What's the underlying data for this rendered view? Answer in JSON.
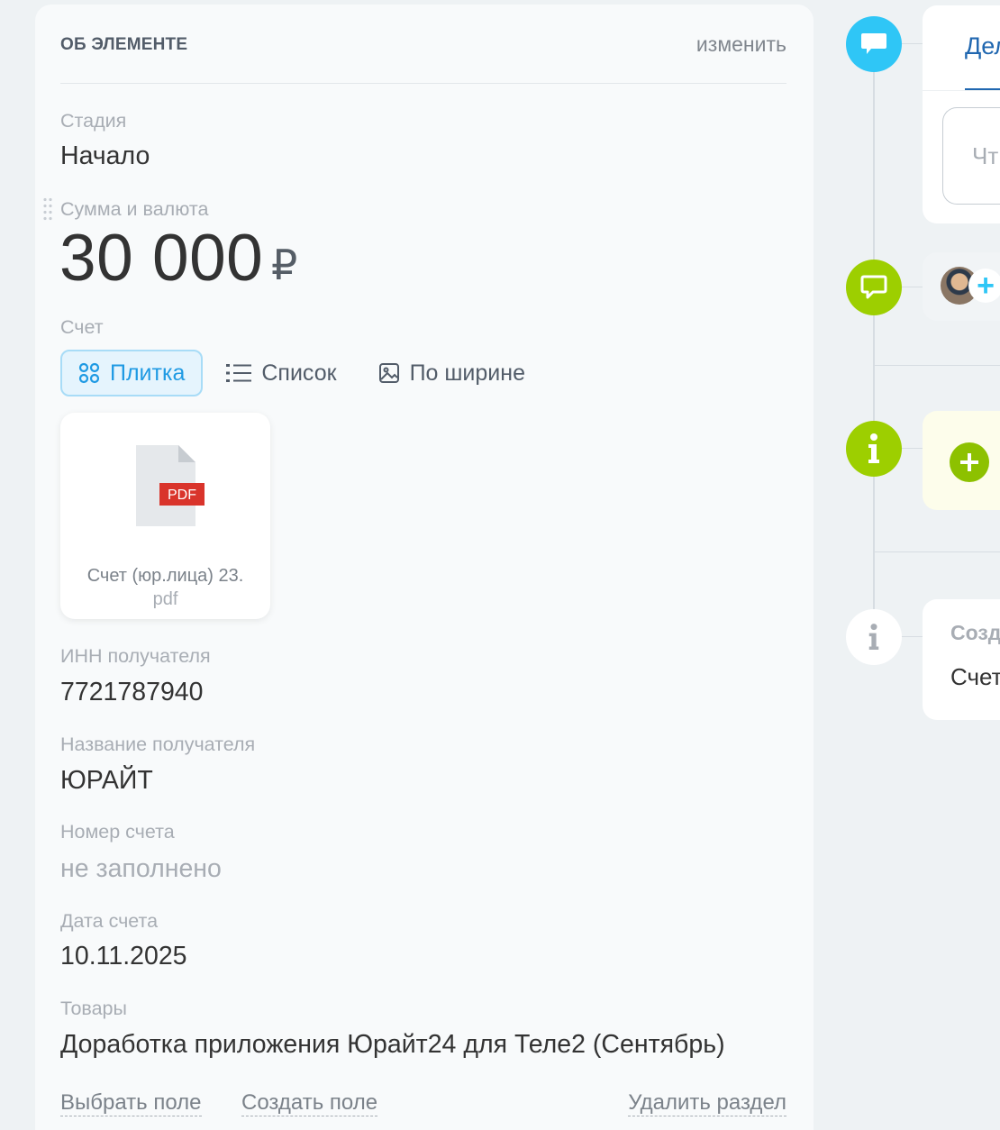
{
  "section": {
    "title": "ОБ ЭЛЕМЕНТЕ",
    "edit_label": "изменить"
  },
  "fields": {
    "stage": {
      "label": "Стадия",
      "value": "Начало"
    },
    "amount": {
      "label": "Сумма и валюта",
      "value": "30 000",
      "currency": "₽"
    },
    "invoice": {
      "label": "Счет"
    },
    "inn": {
      "label": "ИНН получателя",
      "value": "7721787940"
    },
    "recipient": {
      "label": "Название получателя",
      "value": "ЮРАЙТ"
    },
    "invoice_number": {
      "label": "Номер счета",
      "value": "не заполнено"
    },
    "invoice_date": {
      "label": "Дата счета",
      "value": "10.11.2025"
    },
    "products": {
      "label": "Товары",
      "value": "Доработка приложения Юрайт24 для Теле2 (Сентябрь)"
    }
  },
  "view_modes": {
    "tiles": "Плитка",
    "list": "Список",
    "width": "По ширине",
    "active": "tiles"
  },
  "file": {
    "badge": "PDF",
    "name": "Счет (юр.лица) 23.",
    "ext": "pdf"
  },
  "footer": {
    "choose_field": "Выбрать поле",
    "create_field": "Создать поле",
    "delete_section": "Удалить раздел"
  },
  "timeline": {
    "tab_label": "Дел",
    "comment_placeholder": "Чт",
    "created_label": "Созд",
    "created_value": "Счет"
  },
  "colors": {
    "accent_blue": "#2fc6f6",
    "accent_green": "#9dcf00",
    "active_tab": "#2067b0",
    "pdf_red": "#d9342b"
  }
}
